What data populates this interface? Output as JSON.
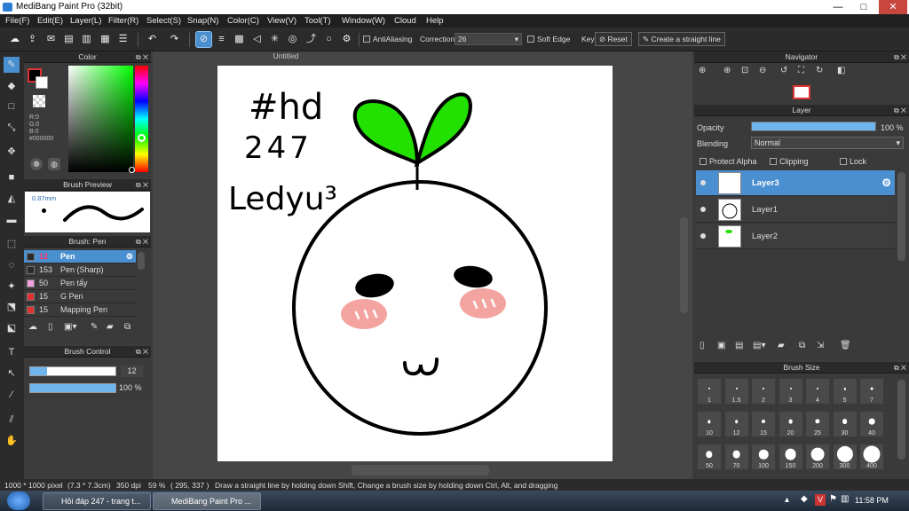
{
  "window": {
    "title": "MediBang Paint Pro (32bit)",
    "minimize": "—",
    "maximize": "□",
    "close": "✕"
  },
  "menu": [
    "File(F)",
    "Edit(E)",
    "Layer(L)",
    "Filter(R)",
    "Select(S)",
    "Snap(N)",
    "Color(C)",
    "View(V)",
    "Tool(T)",
    "Window(W)",
    "Cloud",
    "Help"
  ],
  "toolbar": {
    "antialiasing_label": "AntiAliasing",
    "correction_label": "Correction",
    "correction_value": "26",
    "soft_edge_label": "Soft Edge",
    "key_label": "Key",
    "reset_label": "Reset",
    "straight_line_label": "Create a straight line"
  },
  "color_panel": {
    "title": "Color",
    "r": "R:0",
    "g": "G:0",
    "b": "B:0",
    "hex": "#000000"
  },
  "brush_preview": {
    "title": "Brush Preview",
    "size": "0.87mm"
  },
  "brush_list": {
    "title": "Brush: Pen",
    "items": [
      {
        "size": "12",
        "name": "Pen",
        "color": "#2a2a2a"
      },
      {
        "size": "153",
        "name": "Pen (Sharp)",
        "color": "#2a2a2a"
      },
      {
        "size": "50",
        "name": "Pen tẩy",
        "color": "#f0a0e0"
      },
      {
        "size": "15",
        "name": "G Pen",
        "color": "#e03030"
      },
      {
        "size": "15",
        "name": "Mapping Pen",
        "color": "#e03030"
      }
    ]
  },
  "brush_control": {
    "title": "Brush Control",
    "size_value": "12",
    "opacity_value": "100 %",
    "size_fraction": 0.2,
    "opacity_fraction": 1.0
  },
  "canvas": {
    "tab_title": "Untitled",
    "handwriting_1": "#hd",
    "handwriting_2": "247",
    "handwriting_3": "Ledyu³"
  },
  "navigator": {
    "title": "Navigator"
  },
  "layer_panel": {
    "title": "Layer",
    "opacity_label": "Opacity",
    "opacity_value": "100 %",
    "opacity_fraction": 1.0,
    "blending_label": "Blending",
    "blending_value": "Normal",
    "protect_alpha": "Protect Alpha",
    "clipping": "Clipping",
    "lock": "Lock",
    "layers": [
      "Layer3",
      "Layer1",
      "Layer2"
    ]
  },
  "brush_size": {
    "title": "Brush Size",
    "sizes": [
      "1",
      "1.5",
      "2",
      "3",
      "4",
      "5",
      "7",
      "10",
      "12",
      "15",
      "20",
      "25",
      "30",
      "40",
      "50",
      "70",
      "100",
      "150",
      "200",
      "300",
      "400"
    ]
  },
  "status": {
    "dimensions": "1000 * 1000 pixel",
    "size_cm": "(7.3 * 7.3cm)",
    "dpi": "350 dpi",
    "zoom": "59 %",
    "cursor": "( 295, 337 )",
    "hint": "Draw a straight line by holding down Shift, Change a brush size by holding down Ctrl, Alt, and dragging"
  },
  "taskbar": {
    "tasks": [
      "Hỏi đáp 247 - trang t...",
      "MediBang Paint Pro ..."
    ],
    "time": "11:58 PM"
  },
  "colors": {
    "accent": "#4a8fd0",
    "leaf": "#22e000",
    "blush": "#f4a4a0"
  }
}
